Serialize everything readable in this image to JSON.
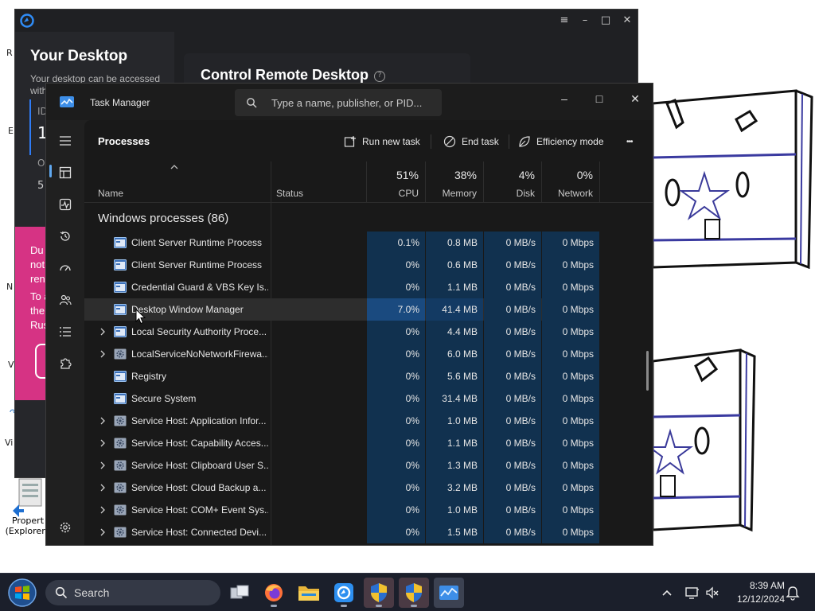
{
  "desktop": {
    "fragments": [
      "R",
      "E",
      "N",
      "V",
      "↷",
      "Vi"
    ],
    "properties_icon_label": "Propert\n(ExplorerP"
  },
  "remote_desktop": {
    "your_desktop_title": "Your Desktop",
    "accessed_text": "Your desktop can be accessed with",
    "id_label": "ID",
    "id_value": "1",
    "o_label": "O",
    "o_value": "5",
    "pink_lines": [
      "Du",
      "not",
      "ren",
      "To a",
      "the",
      "Rus"
    ],
    "control_title": "Control Remote Desktop",
    "help_icon": "?",
    "controls": {
      "menu": "≡",
      "minimize": "–",
      "maximize": "□",
      "close": "✕"
    }
  },
  "task_manager": {
    "title": "Task Manager",
    "search_placeholder": "Type a name, publisher, or PID...",
    "controls": {
      "minimize": "–",
      "maximize": "□",
      "close": "✕"
    },
    "page_title": "Processes",
    "toolbar": {
      "run_new_task": "Run new task",
      "end_task": "End task",
      "efficiency_mode": "Efficiency mode",
      "more": "•••"
    },
    "columns": {
      "name": "Name",
      "status": "Status",
      "cpu_pct": "51%",
      "cpu_label": "CPU",
      "memory_pct": "38%",
      "memory_label": "Memory",
      "disk_pct": "4%",
      "disk_label": "Disk",
      "network_pct": "0%",
      "network_label": "Network"
    },
    "group_title": "Windows processes (86)",
    "processes": [
      {
        "name": "Client Server Runtime Process",
        "cpu": "0.1%",
        "memory": "0.8 MB",
        "disk": "0 MB/s",
        "network": "0 Mbps",
        "expandable": false,
        "icon": "window-icon"
      },
      {
        "name": "Client Server Runtime Process",
        "cpu": "0%",
        "memory": "0.6 MB",
        "disk": "0 MB/s",
        "network": "0 Mbps",
        "expandable": false,
        "icon": "window-icon"
      },
      {
        "name": "Credential Guard & VBS Key Is...",
        "cpu": "0%",
        "memory": "1.1 MB",
        "disk": "0 MB/s",
        "network": "0 Mbps",
        "expandable": false,
        "icon": "window-icon"
      },
      {
        "name": "Desktop Window Manager",
        "cpu": "7.0%",
        "memory": "41.4 MB",
        "disk": "0 MB/s",
        "network": "0 Mbps",
        "expandable": false,
        "icon": "window-icon"
      },
      {
        "name": "Local Security Authority Proce...",
        "cpu": "0%",
        "memory": "4.4 MB",
        "disk": "0 MB/s",
        "network": "0 Mbps",
        "expandable": true,
        "icon": "window-icon"
      },
      {
        "name": "LocalServiceNoNetworkFirewa...",
        "cpu": "0%",
        "memory": "6.0 MB",
        "disk": "0 MB/s",
        "network": "0 Mbps",
        "expandable": true,
        "icon": "gear-icon"
      },
      {
        "name": "Registry",
        "cpu": "0%",
        "memory": "5.6 MB",
        "disk": "0 MB/s",
        "network": "0 Mbps",
        "expandable": false,
        "icon": "window-icon"
      },
      {
        "name": "Secure System",
        "cpu": "0%",
        "memory": "31.4 MB",
        "disk": "0 MB/s",
        "network": "0 Mbps",
        "expandable": false,
        "icon": "window-icon"
      },
      {
        "name": "Service Host: Application Infor...",
        "cpu": "0%",
        "memory": "1.0 MB",
        "disk": "0 MB/s",
        "network": "0 Mbps",
        "expandable": true,
        "icon": "gear-icon"
      },
      {
        "name": "Service Host: Capability Acces...",
        "cpu": "0%",
        "memory": "1.1 MB",
        "disk": "0 MB/s",
        "network": "0 Mbps",
        "expandable": true,
        "icon": "gear-icon"
      },
      {
        "name": "Service Host: Clipboard User S...",
        "cpu": "0%",
        "memory": "1.3 MB",
        "disk": "0 MB/s",
        "network": "0 Mbps",
        "expandable": true,
        "icon": "gear-icon"
      },
      {
        "name": "Service Host: Cloud Backup a...",
        "cpu": "0%",
        "memory": "3.2 MB",
        "disk": "0 MB/s",
        "network": "0 Mbps",
        "expandable": true,
        "icon": "gear-icon"
      },
      {
        "name": "Service Host: COM+ Event Sys...",
        "cpu": "0%",
        "memory": "1.0 MB",
        "disk": "0 MB/s",
        "network": "0 Mbps",
        "expandable": true,
        "icon": "gear-icon"
      },
      {
        "name": "Service Host: Connected Devi...",
        "cpu": "0%",
        "memory": "1.5 MB",
        "disk": "0 MB/s",
        "network": "0 Mbps",
        "expandable": true,
        "icon": "gear-icon"
      }
    ]
  },
  "taskbar": {
    "search_label": "Search",
    "apps": [
      "task-view",
      "firefox",
      "file-explorer",
      "remote-desktop-app",
      "security-shield",
      "security-shield",
      "task-manager"
    ],
    "clock_time": "8:39 AM",
    "clock_date": "12/12/2024"
  },
  "colors": {
    "accent": "#60a8f0",
    "heat_low": "#11314f",
    "heat_high": "#1a4a7f",
    "pink_banner": "#d63384"
  }
}
